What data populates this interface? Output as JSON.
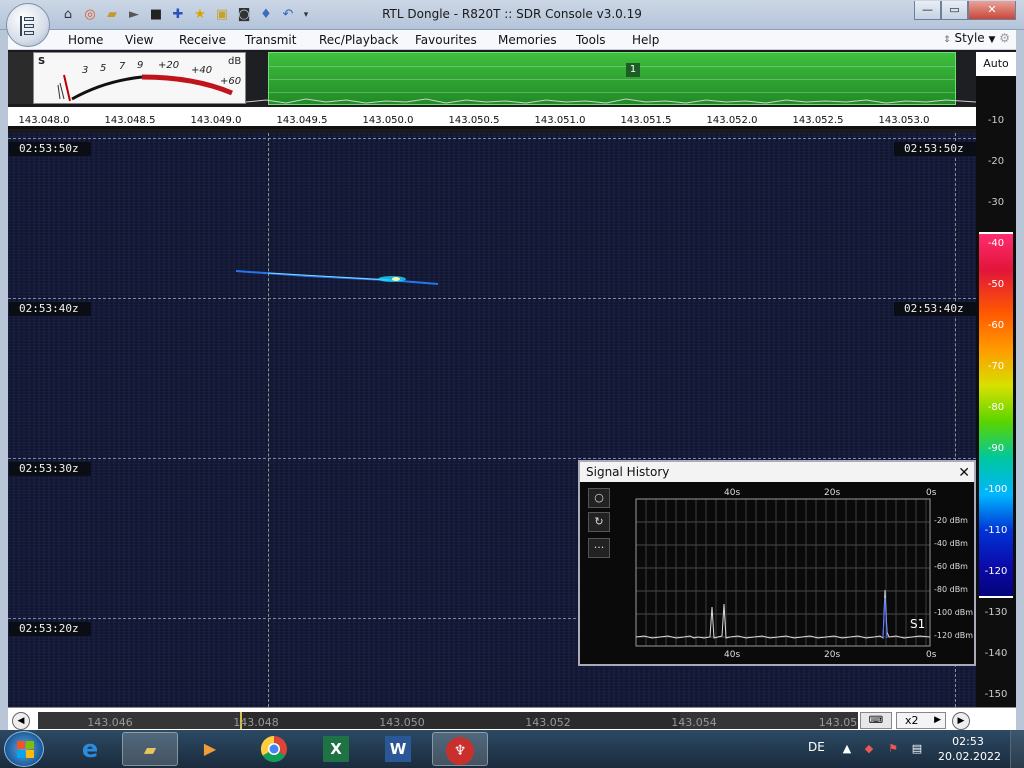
{
  "window": {
    "title": "RTL Dongle - R820T :: SDR Console v3.0.19",
    "minimize_label": "—",
    "maximize_label": "▭",
    "close_label": "✕"
  },
  "quick_access": {
    "icons": [
      "home-icon",
      "lifebuoy-icon",
      "folder-icon",
      "play-icon",
      "stop-icon",
      "plus-icon",
      "star-icon",
      "lock-icon",
      "camera-icon",
      "dropper-icon",
      "undo-icon",
      "dropdown-arrow-icon"
    ]
  },
  "menu": {
    "items": [
      "Home",
      "View",
      "Receive",
      "Transmit",
      "Rec/Playback",
      "Favourites",
      "Memories",
      "Tools",
      "Help"
    ],
    "style_label": "Style"
  },
  "smeter": {
    "s_label": "S",
    "db_label": "dB",
    "scale": [
      "3",
      "5",
      "7",
      "9",
      "+20",
      "+40",
      "+60"
    ]
  },
  "spectrum": {
    "band_number": "1",
    "frequency_ticks": [
      "143.048.0",
      "143.048.5",
      "143.049.0",
      "143.049.5",
      "143.050.0",
      "143.050.5",
      "143.051.0",
      "143.051.5",
      "143.052.0",
      "143.052.5",
      "143.053.0"
    ]
  },
  "waterfall": {
    "timestamps": [
      "02:53:50z",
      "02:53:40z",
      "02:53:30z",
      "02:53:20z"
    ],
    "right_timestamps": [
      "02:53:50z",
      "02:53:40z"
    ]
  },
  "db_scale": {
    "auto_label": "Auto",
    "labels": [
      "-10",
      "-20",
      "-30",
      "-40",
      "-50",
      "-60",
      "-70",
      "-80",
      "-90",
      "-100",
      "-110",
      "-120",
      "-130",
      "-140",
      "-150"
    ]
  },
  "timeline": {
    "labels": [
      "143.046",
      "143.048",
      "143.050",
      "143.052",
      "143.054",
      "143.05"
    ],
    "zoom_value": "x2"
  },
  "signal_history": {
    "title": "Signal History",
    "close_label": "✕",
    "top_axis": [
      "40s",
      "20s",
      "0s"
    ],
    "bottom_axis": [
      "40s",
      "20s",
      "0s"
    ],
    "y_labels": [
      "-20 dBm",
      "-40 dBm",
      "-60 dBm",
      "-80 dBm",
      "-100 dBm",
      "-120 dBm"
    ],
    "s_reading": "S1",
    "tools": [
      "circle-icon",
      "refresh-icon",
      "more-icon"
    ]
  },
  "taskbar": {
    "apps": [
      "internet-explorer-icon",
      "file-explorer-icon",
      "media-player-icon",
      "chrome-icon",
      "excel-icon",
      "word-icon",
      "sdr-console-icon"
    ],
    "language": "DE",
    "time": "02:53",
    "date": "20.02.2022"
  }
}
